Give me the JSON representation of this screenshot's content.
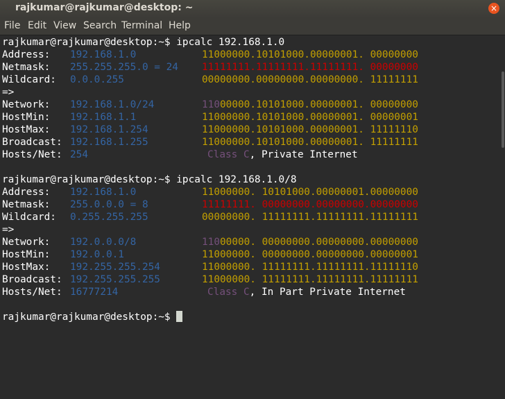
{
  "window": {
    "title": "rajkumar@rajkumar@desktop: ~",
    "close_glyph": "×"
  },
  "menu": [
    "File",
    "Edit",
    "View",
    "Search",
    "Terminal",
    "Help"
  ],
  "colors": {
    "title_bar": "#3c3b37",
    "terminal_bg": "#2b2b2b",
    "close_button": "#e95420",
    "blue": "#3465a4",
    "yellow": "#c4a000",
    "red": "#cc0000",
    "purple": "#75507b"
  },
  "prompt": "rajkumar@rajkumar@desktop:~$",
  "block1": {
    "command": " ipcalc 192.168.1.0",
    "address": {
      "label": "Address:",
      "value": "192.168.1.0",
      "bin": "11000000.10101000.00000001. 00000000"
    },
    "netmask": {
      "label": "Netmask:",
      "value": "255.255.255.0 = 24",
      "bin": "11111111.11111111.11111111. 00000000"
    },
    "wildcard": {
      "label": "Wildcard:",
      "value": "0.0.0.255",
      "bin": "00000000.00000000.00000000. 11111111"
    },
    "arrow": "=>",
    "network": {
      "label": "Network:",
      "value": "192.168.1.0/24",
      "bin_prefix": "110",
      "bin": "00000.10101000.00000001. 00000000"
    },
    "hostmin": {
      "label": "HostMin:",
      "value": "192.168.1.1",
      "bin": "11000000.10101000.00000001. 00000001"
    },
    "hostmax": {
      "label": "HostMax:",
      "value": "192.168.1.254",
      "bin": "11000000.10101000.00000001. 11111110"
    },
    "broadcast": {
      "label": "Broadcast:",
      "value": "192.168.1.255",
      "bin": "11000000.10101000.00000001. 11111111"
    },
    "hosts": {
      "label": "Hosts/Net:",
      "value": "254",
      "class": "Class C",
      "desc": ", Private Internet"
    }
  },
  "block2": {
    "command": " ipcalc 192.168.1.0/8",
    "address": {
      "label": "Address:",
      "value": "192.168.1.0",
      "bin": "11000000. 10101000.00000001.00000000"
    },
    "netmask": {
      "label": "Netmask:",
      "value": "255.0.0.0 = 8",
      "bin": "11111111. 00000000.00000000.00000000"
    },
    "wildcard": {
      "label": "Wildcard:",
      "value": "0.255.255.255",
      "bin": "00000000. 11111111.11111111.11111111"
    },
    "arrow": "=>",
    "network": {
      "label": "Network:",
      "value": "192.0.0.0/8",
      "bin_prefix": "110",
      "bin": "00000. 00000000.00000000.00000000"
    },
    "hostmin": {
      "label": "HostMin:",
      "value": "192.0.0.1",
      "bin": "11000000. 00000000.00000000.00000001"
    },
    "hostmax": {
      "label": "HostMax:",
      "value": "192.255.255.254",
      "bin": "11000000. 11111111.11111111.11111110"
    },
    "broadcast": {
      "label": "Broadcast:",
      "value": "192.255.255.255",
      "bin": "11000000. 11111111.11111111.11111111"
    },
    "hosts": {
      "label": "Hosts/Net:",
      "value": "16777214",
      "class": "Class C",
      "desc": ", In Part Private Internet"
    }
  }
}
